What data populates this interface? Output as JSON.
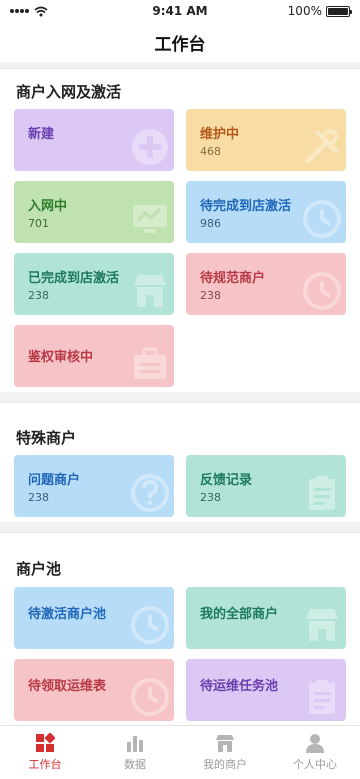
{
  "status_bar": {
    "time": "9:41 AM",
    "battery": "100%",
    "battery_level": 1.0
  },
  "header": {
    "title": "工作台"
  },
  "sections": [
    {
      "title": "商户入网及激活",
      "cards": [
        {
          "label": "新建",
          "count": "",
          "color": "#dcc8f5",
          "icon": "plus-icon"
        },
        {
          "label": "维护中",
          "count": "468",
          "color": "#f7dca4",
          "icon": "tools-icon"
        },
        {
          "label": "入网中",
          "count": "701",
          "color": "#bfe2b0",
          "icon": "monitor-icon"
        },
        {
          "label": "待完成到店激活",
          "count": "986",
          "color": "#b7dcf7",
          "icon": "clock-icon"
        },
        {
          "label": "已完成到店激活",
          "count": "238",
          "color": "#b2e3d8",
          "icon": "store-icon"
        },
        {
          "label": "待规范商户",
          "count": "238",
          "color": "#f6c3c6",
          "icon": "clock-icon"
        },
        {
          "label": "鉴权审核中",
          "count": "",
          "color": "#f6c3c6",
          "icon": "briefcase-icon"
        }
      ]
    },
    {
      "title": "特殊商户",
      "cards": [
        {
          "label": "问题商户",
          "count": "238",
          "color": "#b7dcf7",
          "icon": "question-icon"
        },
        {
          "label": "反馈记录",
          "count": "238",
          "color": "#b2e3d8",
          "icon": "clipboard-icon"
        }
      ]
    },
    {
      "title": "商户池",
      "cards": [
        {
          "label": "待激活商户池",
          "count": "",
          "color": "#b7dcf7",
          "icon": "clock-icon"
        },
        {
          "label": "我的全部商户",
          "count": "",
          "color": "#b2e3d8",
          "icon": "store-icon"
        },
        {
          "label": "待领取运维表",
          "count": "",
          "color": "#f6c3c6",
          "icon": "clock-icon"
        },
        {
          "label": "待运维任务池",
          "count": "",
          "color": "#dcc8f5",
          "icon": "clipboard-icon"
        }
      ]
    }
  ],
  "tabbar": {
    "items": [
      {
        "label": "工作台",
        "icon": "workbench-icon",
        "active": true
      },
      {
        "label": "数据",
        "icon": "chart-icon",
        "active": false
      },
      {
        "label": "我的商户",
        "icon": "store-icon",
        "active": false
      },
      {
        "label": "个人中心",
        "icon": "person-icon",
        "active": false
      }
    ]
  }
}
